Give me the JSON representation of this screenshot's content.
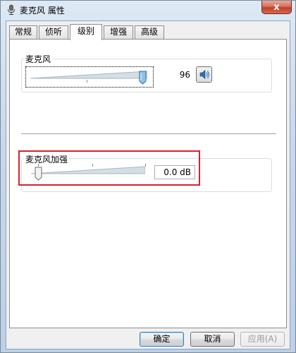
{
  "window": {
    "title": "麦克风 属性",
    "close_glyph": "x"
  },
  "tabs": [
    {
      "label": "常规",
      "active": false
    },
    {
      "label": "侦听",
      "active": false
    },
    {
      "label": "级别",
      "active": true
    },
    {
      "label": "增强",
      "active": false
    },
    {
      "label": "高级",
      "active": false
    }
  ],
  "microphone": {
    "label": "麦克风",
    "level": 96,
    "level_max": 100,
    "value_text": "96",
    "mute_icon": "speaker-icon"
  },
  "boost": {
    "label": "麦克风加强",
    "value_text": "0.0 dB",
    "level_fraction": 0.0,
    "highlighted": true
  },
  "buttons": {
    "ok": "确定",
    "cancel": "取消",
    "apply": "应用(A)"
  },
  "colors": {
    "highlight": "#d7212e",
    "thumb": "#4f9ad6",
    "default_button_border": "#3c7fb1"
  }
}
